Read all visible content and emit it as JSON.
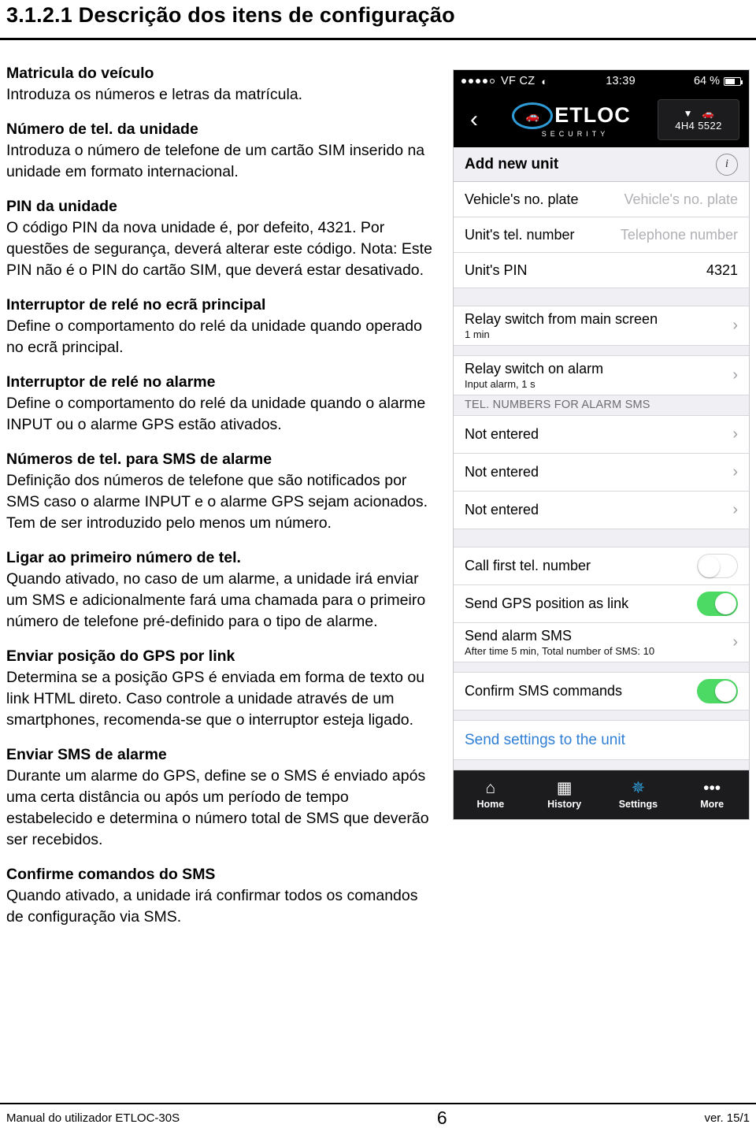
{
  "document": {
    "heading": "3.1.2.1 Descrição dos itens de configuração",
    "sections": [
      {
        "title": "Matricula do veículo",
        "body": "Introduza os números e letras da matrícula."
      },
      {
        "title": "Número de tel. da unidade",
        "body": "Introduza o número de telefone de um cartão SIM inserido na unidade em formato internacional."
      },
      {
        "title": "PIN da unidade",
        "body": "O código PIN da nova unidade é, por defeito, 4321. Por questões de segurança, deverá alterar este código. Nota: Este PIN não é o PIN do cartão SIM, que deverá estar desativado."
      },
      {
        "title": "Interruptor de relé no ecrã principal",
        "body": "Define o comportamento do relé da unidade quando operado no ecrã principal."
      },
      {
        "title": "Interruptor de relé no alarme",
        "body": "Define o comportamento do relé da unidade quando o alarme INPUT ou o alarme GPS estão ativados."
      },
      {
        "title": "Números de tel. para SMS de alarme",
        "body": "Definição dos números de telefone que são notificados por SMS caso o alarme INPUT e o alarme GPS sejam acionados. Tem de ser introduzido pelo menos um número."
      },
      {
        "title": "Ligar ao primeiro número de tel.",
        "body": "Quando ativado, no caso de um alarme, a unidade irá enviar um SMS e adicionalmente fará uma chamada para o primeiro número de telefone pré-definido para o tipo de alarme."
      },
      {
        "title": "Enviar posição do GPS por link",
        "body": "Determina se a posição GPS é enviada em forma de texto ou link HTML direto. Caso controle a unidade através de um smartphones, recomenda-se que o interruptor esteja ligado."
      },
      {
        "title": "Enviar SMS de alarme",
        "body": "Durante um alarme do GPS, define se o SMS é enviado após uma certa distância ou após um período de tempo estabelecido e determina o número total de SMS que deverão ser recebidos."
      },
      {
        "title": "Confirme comandos do SMS",
        "body": "Quando ativado, a unidade irá confirmar todos os comandos de configuração via SMS."
      }
    ],
    "footer": {
      "left": "Manual do utilizador ETLOC-30S",
      "center": "6",
      "right": "ver. 15/1"
    }
  },
  "phone": {
    "statusbar": {
      "carrier": "VF CZ",
      "time": "13:39",
      "battery": "64 %"
    },
    "navbar": {
      "logo_text": "ETLOC",
      "logo_sub": "SECURITY",
      "unit_plate": "4H4 5522"
    },
    "header": {
      "title": "Add new unit",
      "info": "i"
    },
    "fields": [
      {
        "label": "Vehicle's no. plate",
        "placeholder": "Vehicle's no. plate",
        "value": ""
      },
      {
        "label": "Unit's tel. number",
        "placeholder": "Telephone number",
        "value": ""
      },
      {
        "label": "Unit's PIN",
        "placeholder": "",
        "value": "4321"
      }
    ],
    "relay_rows": [
      {
        "main": "Relay switch from main screen",
        "sub": "1 min"
      },
      {
        "main": "Relay switch on alarm",
        "sub": "Input alarm, 1 s"
      }
    ],
    "alarm_group_header": "TEL. NUMBERS FOR ALARM SMS",
    "alarm_numbers": [
      {
        "main": "Not entered"
      },
      {
        "main": "Not entered"
      },
      {
        "main": "Not entered"
      }
    ],
    "toggles": [
      {
        "label": "Call first tel. number",
        "state": "off"
      },
      {
        "label": "Send GPS position as link",
        "state": "on"
      }
    ],
    "sms_row": {
      "main": "Send alarm SMS",
      "sub": "After time 5 min, Total number of SMS: 10"
    },
    "confirm_toggle": {
      "label": "Confirm SMS commands",
      "state": "on"
    },
    "send_settings": "Send settings to the unit",
    "tabbar": [
      {
        "label": "Home",
        "icon": "home-icon",
        "glyph": "⌂",
        "active": false
      },
      {
        "label": "History",
        "icon": "calendar-icon",
        "glyph": "▦",
        "active": false
      },
      {
        "label": "Settings",
        "icon": "gear-icon",
        "glyph": "✱",
        "active": true
      },
      {
        "label": "More",
        "icon": "more-icon",
        "glyph": "•••",
        "active": false
      }
    ]
  }
}
